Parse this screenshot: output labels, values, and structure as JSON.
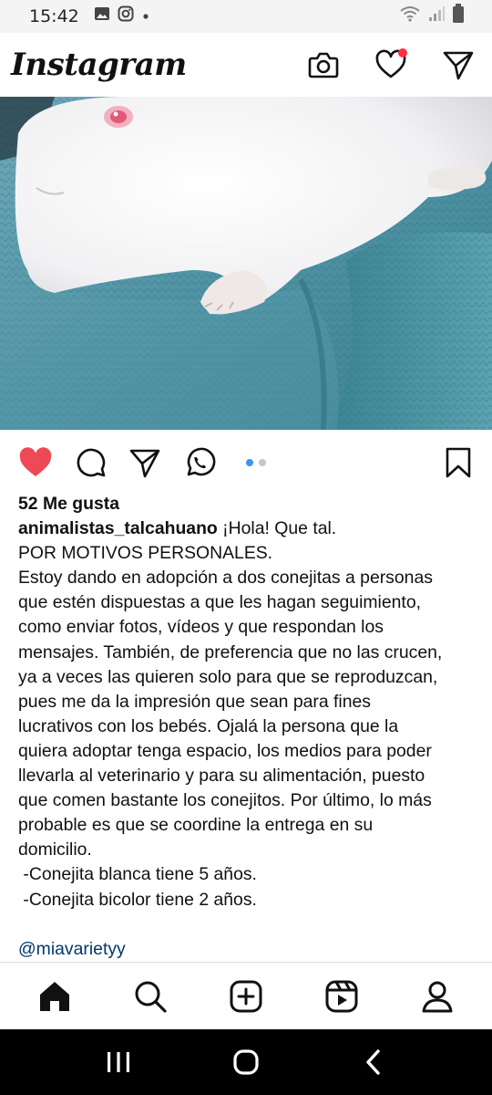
{
  "status_bar": {
    "time": "15:42",
    "icons": [
      "gallery-icon",
      "instagram-icon",
      "dot-icon",
      "wifi-icon",
      "signal-icon",
      "battery-icon"
    ]
  },
  "header": {
    "logo": "Instagram",
    "icons": [
      "camera-icon",
      "heart-icon",
      "send-icon"
    ],
    "notification_color": "#ff3040"
  },
  "post": {
    "image_description_icon": "photo",
    "carousel": {
      "count": 2,
      "active": 1
    },
    "action_icons": [
      "heart-filled-icon",
      "comment-icon",
      "share-icon",
      "whatsapp-icon",
      "bookmark-icon"
    ],
    "like_color": "#ed4956",
    "likes": "52 Me gusta",
    "username": "animalistas_talcahuano",
    "caption_first": " ¡Hola! Que tal.",
    "caption_lines": [
      "POR MOTIVOS PERSONALES.",
      "Estoy dando en adopción a dos conejitas a personas",
      "que estén dispuestas a que les hagan seguimiento,",
      "como enviar fotos, vídeos y que respondan los",
      "mensajes. También, de preferencia que no las crucen,",
      "ya a veces las quieren solo para que se reproduzcan,",
      "pues me da la impresión que sean para fines",
      "lucrativos con los bebés. Ojalá la persona que la",
      "quiera adoptar tenga espacio, los medios para poder",
      "llevarla al veterinario y para su alimentación, puesto",
      "que comen bastante los conejitos. Por último, lo más",
      "probable es que se coordine la entrega en su",
      "domicilio.",
      " -Conejita blanca tiene 5 años.",
      " -Conejita bicolor tiene 2 años."
    ],
    "mention": "@miavarietyy"
  },
  "bottom_nav": {
    "items": [
      "home-icon",
      "search-icon",
      "create-icon",
      "reels-icon",
      "profile-icon"
    ]
  },
  "system_nav": {
    "items": [
      "recents-icon",
      "home-circle-icon",
      "back-icon"
    ]
  }
}
